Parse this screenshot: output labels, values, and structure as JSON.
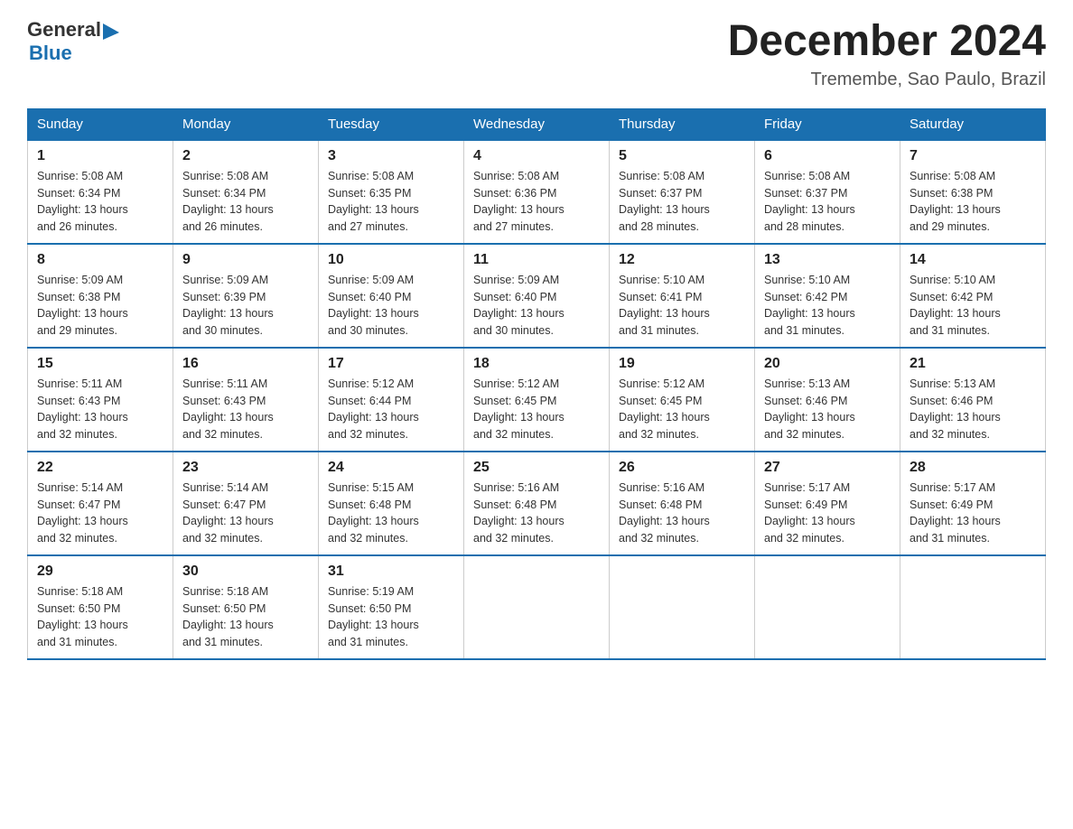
{
  "logo": {
    "general": "General",
    "blue": "Blue",
    "arrow_char": "▶"
  },
  "header": {
    "month": "December 2024",
    "location": "Tremembe, Sao Paulo, Brazil"
  },
  "days_of_week": [
    "Sunday",
    "Monday",
    "Tuesday",
    "Wednesday",
    "Thursday",
    "Friday",
    "Saturday"
  ],
  "weeks": [
    [
      {
        "num": "1",
        "sunrise": "5:08 AM",
        "sunset": "6:34 PM",
        "daylight": "13 hours and 26 minutes."
      },
      {
        "num": "2",
        "sunrise": "5:08 AM",
        "sunset": "6:34 PM",
        "daylight": "13 hours and 26 minutes."
      },
      {
        "num": "3",
        "sunrise": "5:08 AM",
        "sunset": "6:35 PM",
        "daylight": "13 hours and 27 minutes."
      },
      {
        "num": "4",
        "sunrise": "5:08 AM",
        "sunset": "6:36 PM",
        "daylight": "13 hours and 27 minutes."
      },
      {
        "num": "5",
        "sunrise": "5:08 AM",
        "sunset": "6:37 PM",
        "daylight": "13 hours and 28 minutes."
      },
      {
        "num": "6",
        "sunrise": "5:08 AM",
        "sunset": "6:37 PM",
        "daylight": "13 hours and 28 minutes."
      },
      {
        "num": "7",
        "sunrise": "5:08 AM",
        "sunset": "6:38 PM",
        "daylight": "13 hours and 29 minutes."
      }
    ],
    [
      {
        "num": "8",
        "sunrise": "5:09 AM",
        "sunset": "6:38 PM",
        "daylight": "13 hours and 29 minutes."
      },
      {
        "num": "9",
        "sunrise": "5:09 AM",
        "sunset": "6:39 PM",
        "daylight": "13 hours and 30 minutes."
      },
      {
        "num": "10",
        "sunrise": "5:09 AM",
        "sunset": "6:40 PM",
        "daylight": "13 hours and 30 minutes."
      },
      {
        "num": "11",
        "sunrise": "5:09 AM",
        "sunset": "6:40 PM",
        "daylight": "13 hours and 30 minutes."
      },
      {
        "num": "12",
        "sunrise": "5:10 AM",
        "sunset": "6:41 PM",
        "daylight": "13 hours and 31 minutes."
      },
      {
        "num": "13",
        "sunrise": "5:10 AM",
        "sunset": "6:42 PM",
        "daylight": "13 hours and 31 minutes."
      },
      {
        "num": "14",
        "sunrise": "5:10 AM",
        "sunset": "6:42 PM",
        "daylight": "13 hours and 31 minutes."
      }
    ],
    [
      {
        "num": "15",
        "sunrise": "5:11 AM",
        "sunset": "6:43 PM",
        "daylight": "13 hours and 32 minutes."
      },
      {
        "num": "16",
        "sunrise": "5:11 AM",
        "sunset": "6:43 PM",
        "daylight": "13 hours and 32 minutes."
      },
      {
        "num": "17",
        "sunrise": "5:12 AM",
        "sunset": "6:44 PM",
        "daylight": "13 hours and 32 minutes."
      },
      {
        "num": "18",
        "sunrise": "5:12 AM",
        "sunset": "6:45 PM",
        "daylight": "13 hours and 32 minutes."
      },
      {
        "num": "19",
        "sunrise": "5:12 AM",
        "sunset": "6:45 PM",
        "daylight": "13 hours and 32 minutes."
      },
      {
        "num": "20",
        "sunrise": "5:13 AM",
        "sunset": "6:46 PM",
        "daylight": "13 hours and 32 minutes."
      },
      {
        "num": "21",
        "sunrise": "5:13 AM",
        "sunset": "6:46 PM",
        "daylight": "13 hours and 32 minutes."
      }
    ],
    [
      {
        "num": "22",
        "sunrise": "5:14 AM",
        "sunset": "6:47 PM",
        "daylight": "13 hours and 32 minutes."
      },
      {
        "num": "23",
        "sunrise": "5:14 AM",
        "sunset": "6:47 PM",
        "daylight": "13 hours and 32 minutes."
      },
      {
        "num": "24",
        "sunrise": "5:15 AM",
        "sunset": "6:48 PM",
        "daylight": "13 hours and 32 minutes."
      },
      {
        "num": "25",
        "sunrise": "5:16 AM",
        "sunset": "6:48 PM",
        "daylight": "13 hours and 32 minutes."
      },
      {
        "num": "26",
        "sunrise": "5:16 AM",
        "sunset": "6:48 PM",
        "daylight": "13 hours and 32 minutes."
      },
      {
        "num": "27",
        "sunrise": "5:17 AM",
        "sunset": "6:49 PM",
        "daylight": "13 hours and 32 minutes."
      },
      {
        "num": "28",
        "sunrise": "5:17 AM",
        "sunset": "6:49 PM",
        "daylight": "13 hours and 31 minutes."
      }
    ],
    [
      {
        "num": "29",
        "sunrise": "5:18 AM",
        "sunset": "6:50 PM",
        "daylight": "13 hours and 31 minutes."
      },
      {
        "num": "30",
        "sunrise": "5:18 AM",
        "sunset": "6:50 PM",
        "daylight": "13 hours and 31 minutes."
      },
      {
        "num": "31",
        "sunrise": "5:19 AM",
        "sunset": "6:50 PM",
        "daylight": "13 hours and 31 minutes."
      },
      null,
      null,
      null,
      null
    ]
  ],
  "labels": {
    "sunrise": "Sunrise:",
    "sunset": "Sunset:",
    "daylight": "Daylight:"
  }
}
